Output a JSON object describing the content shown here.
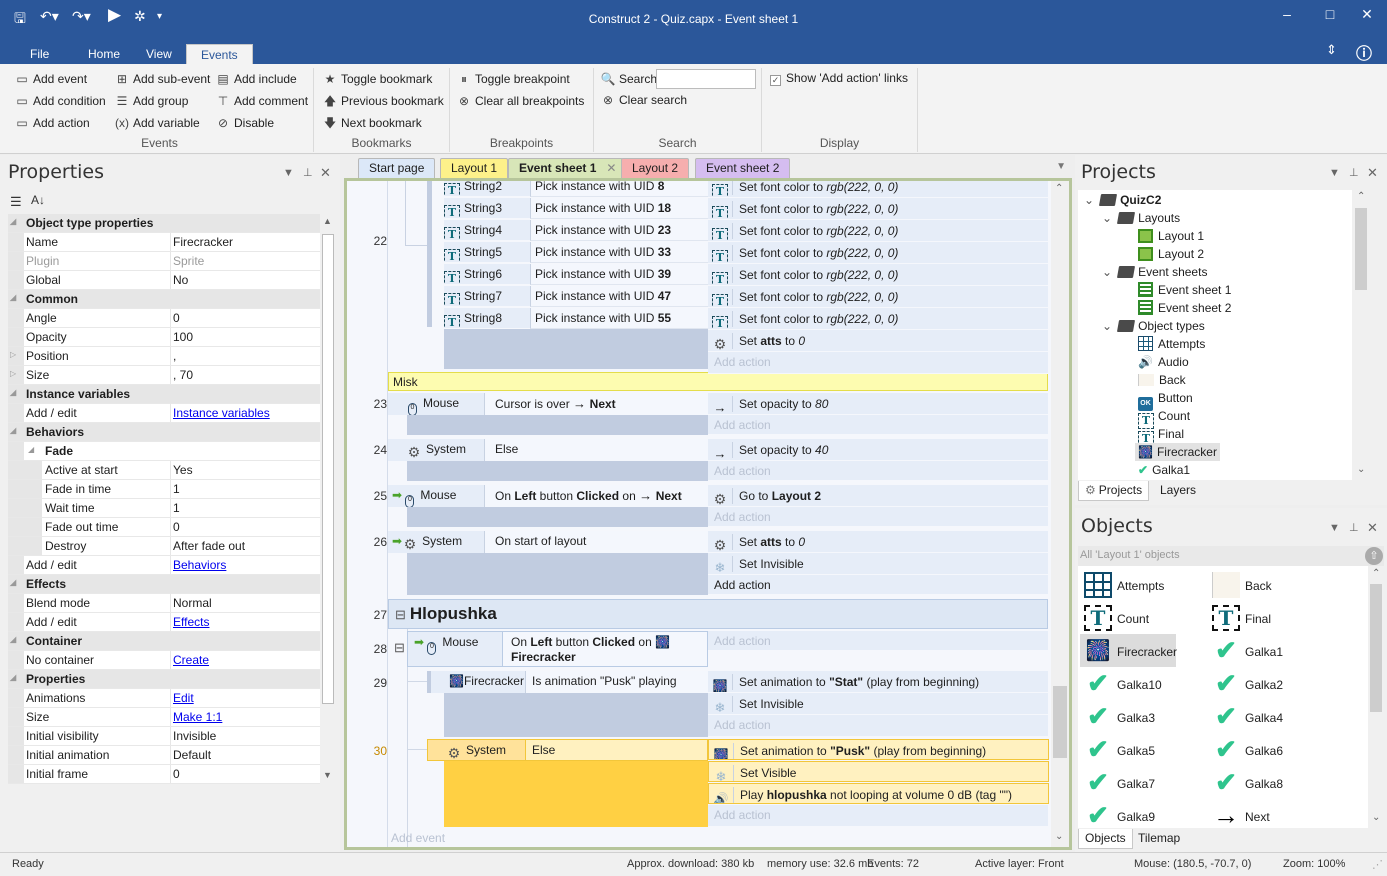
{
  "window": {
    "title": "Construct 2 - Quiz.capx - Event sheet 1",
    "controls": {
      "minimize": "–",
      "maximize": "□",
      "close": "✕"
    }
  },
  "quick_access": {
    "save": "save-icon",
    "undo": "undo-icon",
    "redo": "redo-icon",
    "run": "play-icon",
    "debug": "debug-icon",
    "customize": "▾"
  },
  "ribbon": {
    "tabs": [
      {
        "label": "File"
      },
      {
        "label": "Home"
      },
      {
        "label": "View"
      },
      {
        "label": "Events",
        "active": true
      }
    ],
    "groups": {
      "events": {
        "label": "Events",
        "items": [
          "Add event",
          "Add condition",
          "Add action",
          "Add sub-event",
          "Add group",
          "Add variable",
          "Add include",
          "Add comment",
          "Disable"
        ]
      },
      "bookmarks": {
        "label": "Bookmarks",
        "items": [
          "Toggle bookmark",
          "Previous bookmark",
          "Next bookmark"
        ]
      },
      "breakpoints": {
        "label": "Breakpoints",
        "items": [
          "Toggle breakpoint",
          "Clear all breakpoints"
        ]
      },
      "search": {
        "label": "Search",
        "search_label": "Search",
        "search_value": "",
        "clear_label": "Clear search"
      },
      "display": {
        "label": "Display",
        "show_add_action": "Show 'Add action' links",
        "show_add_action_checked": true
      }
    }
  },
  "properties": {
    "title": "Properties",
    "rows": [
      {
        "type": "cat",
        "k": "Object type properties"
      },
      {
        "k": "Name",
        "v": "Firecracker"
      },
      {
        "k": "Plugin",
        "v": "Sprite",
        "dim": true
      },
      {
        "k": "Global",
        "v": "No"
      },
      {
        "type": "cat",
        "k": "Common"
      },
      {
        "k": "Angle",
        "v": "0"
      },
      {
        "k": "Opacity",
        "v": "100"
      },
      {
        "k": "Position",
        "v": ",",
        "expandable": true
      },
      {
        "k": "Size",
        "v": ", 70",
        "expandable": true
      },
      {
        "type": "cat",
        "k": "Instance variables"
      },
      {
        "k": "Add / edit",
        "v": "Instance variables",
        "link": true
      },
      {
        "type": "cat",
        "k": "Behaviors"
      },
      {
        "type": "subcat",
        "k": "Fade"
      },
      {
        "k": "Active at start",
        "v": "Yes",
        "indent": true
      },
      {
        "k": "Fade in time",
        "v": "1",
        "indent": true
      },
      {
        "k": "Wait time",
        "v": "1",
        "indent": true
      },
      {
        "k": "Fade out time",
        "v": "0",
        "indent": true
      },
      {
        "k": "Destroy",
        "v": "After fade out",
        "indent": true
      },
      {
        "k": "Add / edit",
        "v": "Behaviors",
        "link": true
      },
      {
        "type": "cat",
        "k": "Effects"
      },
      {
        "k": "Blend mode",
        "v": "Normal"
      },
      {
        "k": "Add / edit",
        "v": "Effects",
        "link": true
      },
      {
        "type": "cat",
        "k": "Container"
      },
      {
        "k": "No container",
        "v": "Create",
        "link": true
      },
      {
        "type": "cat",
        "k": "Properties"
      },
      {
        "k": "Animations",
        "v": "Edit",
        "link": true
      },
      {
        "k": "Size",
        "v": "Make 1:1",
        "link": true
      },
      {
        "k": "Initial visibility",
        "v": "Invisible"
      },
      {
        "k": "Initial animation",
        "v": "Default"
      },
      {
        "k": "Initial frame",
        "v": "0"
      }
    ]
  },
  "doc_tabs": [
    {
      "label": "Start page",
      "color": "#dce8f8"
    },
    {
      "label": "Layout 1",
      "color": "#fdf18a"
    },
    {
      "label": "Event sheet 1",
      "color": "#d8e6b8",
      "active": true,
      "close": "✕"
    },
    {
      "label": "Layout 2",
      "color": "#f6aeae"
    },
    {
      "label": "Event sheet 2",
      "color": "#d5bdf0"
    }
  ],
  "event_sheet": {
    "event22": {
      "number": "22",
      "conditions": [
        {
          "obj": "String2",
          "text": "Pick instance with UID ",
          "bold": "8"
        },
        {
          "obj": "String3",
          "text": "Pick instance with UID ",
          "bold": "18"
        },
        {
          "obj": "String4",
          "text": "Pick instance with UID ",
          "bold": "23"
        },
        {
          "obj": "String5",
          "text": "Pick instance with UID ",
          "bold": "33"
        },
        {
          "obj": "String6",
          "text": "Pick instance with UID ",
          "bold": "39"
        },
        {
          "obj": "String7",
          "text": "Pick instance with UID ",
          "bold": "47"
        },
        {
          "obj": "String8",
          "text": "Pick instance with UID ",
          "bold": "55"
        }
      ],
      "action_text": "Set font color to ",
      "action_value": "rgb(222, 0, 0)",
      "extra_action": {
        "pre": "Set ",
        "bold": "atts",
        "mid": " to ",
        "it": "0"
      },
      "add_action": "Add action"
    },
    "comment": "Misk",
    "event23": {
      "number": "23",
      "obj": "Mouse",
      "cond": "Cursor is over ",
      "cond_bold": "Next",
      "act_pre": "Set opacity to ",
      "act_it": "80",
      "add_action": "Add action"
    },
    "event24": {
      "number": "24",
      "obj": "System",
      "cond": "Else",
      "act_pre": "Set opacity to ",
      "act_it": "40",
      "add_action": "Add action"
    },
    "event25": {
      "number": "25",
      "obj": "Mouse",
      "cond_a": "On ",
      "cond_b": "Left",
      "cond_c": " button ",
      "cond_d": "Clicked",
      "cond_e": " on ",
      "cond_f": "Next",
      "act_pre": "Go to ",
      "act_bold": "Layout 2",
      "add_action": "Add action"
    },
    "event26": {
      "number": "26",
      "obj": "System",
      "cond": "On start of layout",
      "act1_pre": "Set ",
      "act1_bold": "atts",
      "act1_mid": " to ",
      "act1_it": "0",
      "act2": "Set Invisible",
      "add_action": "Add action"
    },
    "group27": {
      "number": "27",
      "title": "Hlopushka",
      "toggle": "⊟"
    },
    "event28": {
      "number": "28",
      "obj": "Mouse",
      "cond_a": "On ",
      "cond_b": "Left",
      "cond_c": " button ",
      "cond_d": "Clicked",
      "cond_e": " on ",
      "cond_f": "Firecracker",
      "add_action": "Add action",
      "toggle": "⊟"
    },
    "event29": {
      "number": "29",
      "obj": "Firecracker",
      "cond": "Is animation \"Pusk\" playing",
      "act1_pre": "Set animation to ",
      "act1_bold": "\"Stat\"",
      "act1_post": " (play from beginning)",
      "act2": "Set Invisible",
      "add_action": "Add action"
    },
    "event30": {
      "number": "30",
      "obj": "System",
      "cond": "Else",
      "act1_pre": "Set animation to ",
      "act1_bold": "\"Pusk\"",
      "act1_post": " (play from beginning)",
      "act2": "Set Visible",
      "act3_pre": "Play ",
      "act3_bold": "hlopushka",
      "act3_post": " not looping at volume 0 dB (tag \"\")",
      "add_action": "Add action"
    },
    "add_event": "Add event"
  },
  "projects": {
    "title": "Projects",
    "tree": {
      "root": "QuizC2",
      "layouts_folder": "Layouts",
      "layouts": [
        "Layout 1",
        "Layout 2"
      ],
      "eventsheets_folder": "Event sheets",
      "eventsheets": [
        "Event sheet 1",
        "Event sheet 2"
      ],
      "objtypes_folder": "Object types",
      "objtypes": [
        "Attempts",
        "Audio",
        "Back",
        "Button",
        "Count",
        "Final",
        "Firecracker",
        "Galka1"
      ],
      "selected": "Firecracker"
    },
    "tabs": [
      "Projects",
      "Layers"
    ]
  },
  "objects": {
    "title": "Objects",
    "filter": "All 'Layout 1' objects",
    "items": [
      "Attempts",
      "Back",
      "Count",
      "Final",
      "Firecracker",
      "Galka1",
      "Galka10",
      "Galka2",
      "Galka3",
      "Galka4",
      "Galka5",
      "Galka6",
      "Galka7",
      "Galka8",
      "Galka9",
      "Next"
    ],
    "selected": "Firecracker",
    "tabs": [
      "Objects",
      "Tilemap"
    ]
  },
  "status": {
    "ready": "Ready",
    "download": "Approx. download: 380 kb",
    "memory": "memory use: 32.6 mb",
    "events": "Events: 72",
    "layer": "Active layer: Front",
    "mouse": "Mouse: (180.5, -70.7, 0)",
    "zoom": "Zoom: 100%"
  }
}
